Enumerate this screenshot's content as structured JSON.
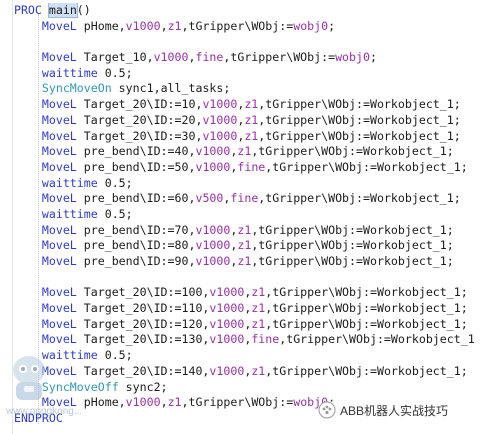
{
  "editor": {
    "lines": [
      {
        "segs": [
          {
            "t": "  "
          },
          {
            "t": "PROC",
            "c": "kw"
          },
          {
            "t": " "
          },
          {
            "t": "main",
            "c": "hl"
          },
          {
            "t": "()"
          }
        ]
      },
      {
        "segs": [
          {
            "t": "      "
          },
          {
            "t": "MoveL",
            "c": "kw"
          },
          {
            "t": " pHome,"
          },
          {
            "t": "v1000",
            "c": "num"
          },
          {
            "t": ","
          },
          {
            "t": "z1",
            "c": "num"
          },
          {
            "t": ",tGripper\\WObj:="
          },
          {
            "t": "wobj0",
            "c": "num"
          },
          {
            "t": ";"
          }
        ]
      },
      {
        "segs": [
          {
            "t": ""
          }
        ]
      },
      {
        "segs": [
          {
            "t": "      "
          },
          {
            "t": "MoveL",
            "c": "kw"
          },
          {
            "t": " Target_10,"
          },
          {
            "t": "v1000",
            "c": "num"
          },
          {
            "t": ","
          },
          {
            "t": "fine",
            "c": "num"
          },
          {
            "t": ",tGripper\\WObj:="
          },
          {
            "t": "wobj0",
            "c": "num"
          },
          {
            "t": ";"
          }
        ]
      },
      {
        "segs": [
          {
            "t": "      "
          },
          {
            "t": "waittime",
            "c": "kw"
          },
          {
            "t": " 0.5;"
          }
        ]
      },
      {
        "segs": [
          {
            "t": "      "
          },
          {
            "t": "SyncMoveOn",
            "c": "cf"
          },
          {
            "t": " sync1,all_tasks;"
          }
        ]
      },
      {
        "segs": [
          {
            "t": "      "
          },
          {
            "t": "MoveL",
            "c": "kw"
          },
          {
            "t": " Target_20\\ID:=10,"
          },
          {
            "t": "v1000",
            "c": "num"
          },
          {
            "t": ","
          },
          {
            "t": "z1",
            "c": "num"
          },
          {
            "t": ",tGripper\\WObj:=Workobject_1;"
          }
        ]
      },
      {
        "segs": [
          {
            "t": "      "
          },
          {
            "t": "MoveL",
            "c": "kw"
          },
          {
            "t": " Target_20\\ID:=20,"
          },
          {
            "t": "v1000",
            "c": "num"
          },
          {
            "t": ","
          },
          {
            "t": "z1",
            "c": "num"
          },
          {
            "t": ",tGripper\\WObj:=Workobject_1;"
          }
        ]
      },
      {
        "segs": [
          {
            "t": "      "
          },
          {
            "t": "MoveL",
            "c": "kw"
          },
          {
            "t": " Target_20\\ID:=30,"
          },
          {
            "t": "v1000",
            "c": "num"
          },
          {
            "t": ","
          },
          {
            "t": "z1",
            "c": "num"
          },
          {
            "t": ",tGripper\\WObj:=Workobject_1;"
          }
        ]
      },
      {
        "segs": [
          {
            "t": "      "
          },
          {
            "t": "MoveL",
            "c": "kw"
          },
          {
            "t": " pre_bend\\ID:=40,"
          },
          {
            "t": "v1000",
            "c": "num"
          },
          {
            "t": ","
          },
          {
            "t": "z1",
            "c": "num"
          },
          {
            "t": ",tGripper\\WObj:=Workobject_1;"
          }
        ]
      },
      {
        "segs": [
          {
            "t": "      "
          },
          {
            "t": "MoveL",
            "c": "kw"
          },
          {
            "t": " pre_bend\\ID:=50,"
          },
          {
            "t": "v1000",
            "c": "num"
          },
          {
            "t": ","
          },
          {
            "t": "fine",
            "c": "num"
          },
          {
            "t": ",tGripper\\WObj:=Workobject_1;"
          }
        ]
      },
      {
        "segs": [
          {
            "t": "      "
          },
          {
            "t": "waittime",
            "c": "kw"
          },
          {
            "t": " 0.5;"
          }
        ]
      },
      {
        "segs": [
          {
            "t": "      "
          },
          {
            "t": "MoveL",
            "c": "kw"
          },
          {
            "t": " pre_bend\\ID:=60,"
          },
          {
            "t": "v500",
            "c": "num"
          },
          {
            "t": ","
          },
          {
            "t": "fine",
            "c": "num"
          },
          {
            "t": ",tGripper\\WObj:=Workobject_1;"
          }
        ]
      },
      {
        "segs": [
          {
            "t": "      "
          },
          {
            "t": "waittime",
            "c": "kw"
          },
          {
            "t": " 0.5;"
          }
        ]
      },
      {
        "segs": [
          {
            "t": "      "
          },
          {
            "t": "MoveL",
            "c": "kw"
          },
          {
            "t": " pre_bend\\ID:=70,"
          },
          {
            "t": "v1000",
            "c": "num"
          },
          {
            "t": ","
          },
          {
            "t": "z1",
            "c": "num"
          },
          {
            "t": ",tGripper\\WObj:=Workobject_1;"
          }
        ]
      },
      {
        "segs": [
          {
            "t": "      "
          },
          {
            "t": "MoveL",
            "c": "kw"
          },
          {
            "t": " pre_bend\\ID:=80,"
          },
          {
            "t": "v1000",
            "c": "num"
          },
          {
            "t": ","
          },
          {
            "t": "z1",
            "c": "num"
          },
          {
            "t": ",tGripper\\WObj:=Workobject_1;"
          }
        ]
      },
      {
        "segs": [
          {
            "t": "      "
          },
          {
            "t": "MoveL",
            "c": "kw"
          },
          {
            "t": " pre_bend\\ID:=90,"
          },
          {
            "t": "v1000",
            "c": "num"
          },
          {
            "t": ","
          },
          {
            "t": "z1",
            "c": "num"
          },
          {
            "t": ",tGripper\\WObj:=Workobject_1;"
          }
        ]
      },
      {
        "segs": [
          {
            "t": ""
          }
        ]
      },
      {
        "segs": [
          {
            "t": "      "
          },
          {
            "t": "MoveL",
            "c": "kw"
          },
          {
            "t": " Target_20\\ID:=100,"
          },
          {
            "t": "v1000",
            "c": "num"
          },
          {
            "t": ","
          },
          {
            "t": "z1",
            "c": "num"
          },
          {
            "t": ",tGripper\\WObj:=Workobject_1;"
          }
        ]
      },
      {
        "segs": [
          {
            "t": "      "
          },
          {
            "t": "MoveL",
            "c": "kw"
          },
          {
            "t": " Target_20\\ID:=110,"
          },
          {
            "t": "v1000",
            "c": "num"
          },
          {
            "t": ","
          },
          {
            "t": "z1",
            "c": "num"
          },
          {
            "t": ",tGripper\\WObj:=Workobject_1;"
          }
        ]
      },
      {
        "segs": [
          {
            "t": "      "
          },
          {
            "t": "MoveL",
            "c": "kw"
          },
          {
            "t": " Target_20\\ID:=120,"
          },
          {
            "t": "v1000",
            "c": "num"
          },
          {
            "t": ","
          },
          {
            "t": "z1",
            "c": "num"
          },
          {
            "t": ",tGripper\\WObj:=Workobject_1;"
          }
        ]
      },
      {
        "segs": [
          {
            "t": "      "
          },
          {
            "t": "MoveL",
            "c": "kw"
          },
          {
            "t": " Target_20\\ID:=130,"
          },
          {
            "t": "v1000",
            "c": "num"
          },
          {
            "t": ","
          },
          {
            "t": "fine",
            "c": "num"
          },
          {
            "t": ",tGripper\\WObj:=Workobject_1"
          }
        ]
      },
      {
        "segs": [
          {
            "t": "      "
          },
          {
            "t": "waittime",
            "c": "kw"
          },
          {
            "t": " 0.5;"
          }
        ]
      },
      {
        "segs": [
          {
            "t": "      "
          },
          {
            "t": "MoveL",
            "c": "kw"
          },
          {
            "t": " Target_20\\ID:=140,"
          },
          {
            "t": "v1000",
            "c": "num"
          },
          {
            "t": ","
          },
          {
            "t": "z1",
            "c": "num"
          },
          {
            "t": ",tGripper\\WObj:=Workobject_1;"
          }
        ]
      },
      {
        "segs": [
          {
            "t": "      "
          },
          {
            "t": "SyncMoveOff",
            "c": "cf"
          },
          {
            "t": " sync2;"
          }
        ]
      },
      {
        "segs": [
          {
            "t": "      "
          },
          {
            "t": "MoveL",
            "c": "kw"
          },
          {
            "t": " pHome,"
          },
          {
            "t": "v1000",
            "c": "num"
          },
          {
            "t": ","
          },
          {
            "t": "z1",
            "c": "num"
          },
          {
            "t": ",tGripper\\WObj:="
          },
          {
            "t": "wobj0",
            "c": "num"
          },
          {
            "t": ";"
          }
        ]
      },
      {
        "segs": [
          {
            "t": "  "
          },
          {
            "t": "ENDPROC",
            "c": "kw"
          }
        ]
      }
    ]
  },
  "watermark": {
    "left_url": "www.gongkong...",
    "right_text": "ABB机器人实战技巧"
  },
  "colors": {
    "keyword": "#2f3ad6",
    "constant": "#9a2fa8",
    "sync": "#2f9ab0",
    "highlight": "#cfe0f5"
  }
}
